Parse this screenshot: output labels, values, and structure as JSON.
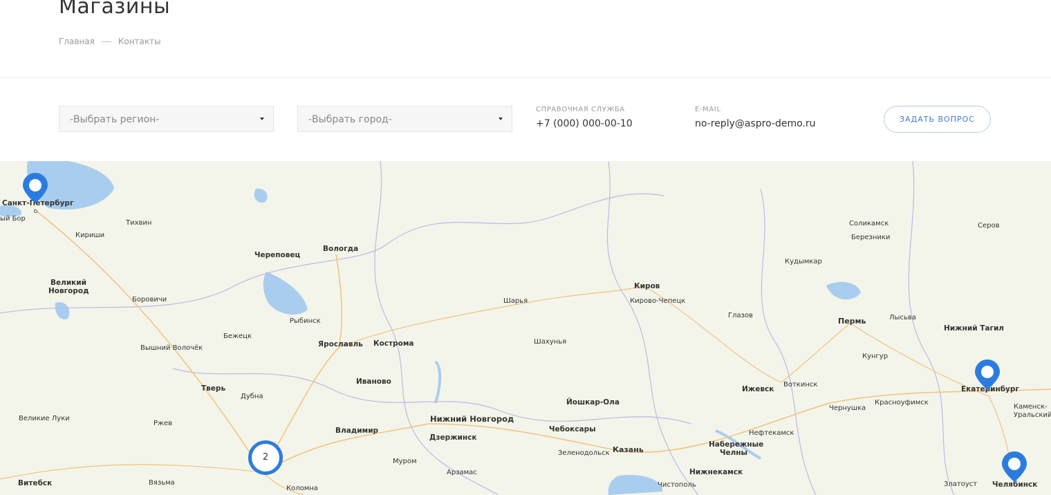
{
  "page": {
    "title": "Магазины",
    "breadcrumb": [
      "Главная",
      "Контакты"
    ]
  },
  "filters": {
    "region_placeholder": "-Выбрать регион-",
    "city_placeholder": "-Выбрать город-"
  },
  "contacts": {
    "phone_label": "СПРАВОЧНАЯ СЛУЖБА",
    "phone": "+7 (000) 000-00-10",
    "email_label": "E-MAIL",
    "email": "no-reply@aspro-demo.ru"
  },
  "ask_button": "ЗАДАТЬ ВОПРОС",
  "colors": {
    "accent": "#2b7ce0",
    "map_bg": "#f3f5ea",
    "water": "#a9cdef"
  },
  "map": {
    "cluster_count": "2",
    "cities": {
      "spb": "Санкт-Петербург",
      "sosnovy": "ый Бор",
      "tikhvin": "Тихвин",
      "kirishi": "Кириши",
      "vnovgorod1": "Великий",
      "vnovgorod2": "Новгород",
      "borovichi": "Боровичи",
      "cherepovets": "Череповец",
      "vologda": "Вологда",
      "rybinsk": "Рыбинск",
      "bezhetsk": "Бежецк",
      "vvolochek": "Вышний Волочёк",
      "yaroslavl": "Ярославль",
      "kostroma": "Кострома",
      "tver": "Тверь",
      "dubna": "Дубна",
      "ivanovo": "Иваново",
      "vluki": "Великие Луки",
      "rzhev": "Ржев",
      "vladimir": "Владимир",
      "vitebsk": "Витебск",
      "vyazma": "Вязьма",
      "kolomna": "Коломна",
      "murom": "Муром",
      "arzamas": "Арзамас",
      "nnovgorod": "Нижний Новгород",
      "dzerzhinsk": "Дзержинск",
      "sharya": "Шарья",
      "shakhunya": "Шахунья",
      "kirov": "Киров",
      "kirovochepetsk": "Кирово-Чепецк",
      "yoshkarola": "Йошкар-Ола",
      "cheboksary": "Чебоксары",
      "zelenodolsk": "Зеленодольск",
      "kazan": "Казань",
      "chistopol": "Чистополь",
      "nizhnekamsk": "Нижнекамск",
      "nchelny1": "Набережные",
      "nchelny2": "Челны",
      "neftekamsk": "Нефтекамск",
      "izhevsk": "Ижевск",
      "votkinsk": "Воткинск",
      "glazov": "Глазов",
      "kudymkar": "Кудымкар",
      "solikamsk": "Соликамск",
      "berezniki": "Березники",
      "perm": "Пермь",
      "lysva": "Лысьва",
      "kungur": "Кунгур",
      "chernushka": "Чернушка",
      "krasnoufimsk": "Красноуфимск",
      "serov": "Серов",
      "ntagil": "Нижний Тагил",
      "ekb": "Екатеринбург",
      "kamensk1": "Каменск-",
      "kamensk2": "Уральский",
      "zlatoust": "Златоуст",
      "chelyabinsk": "Челябинск"
    }
  }
}
